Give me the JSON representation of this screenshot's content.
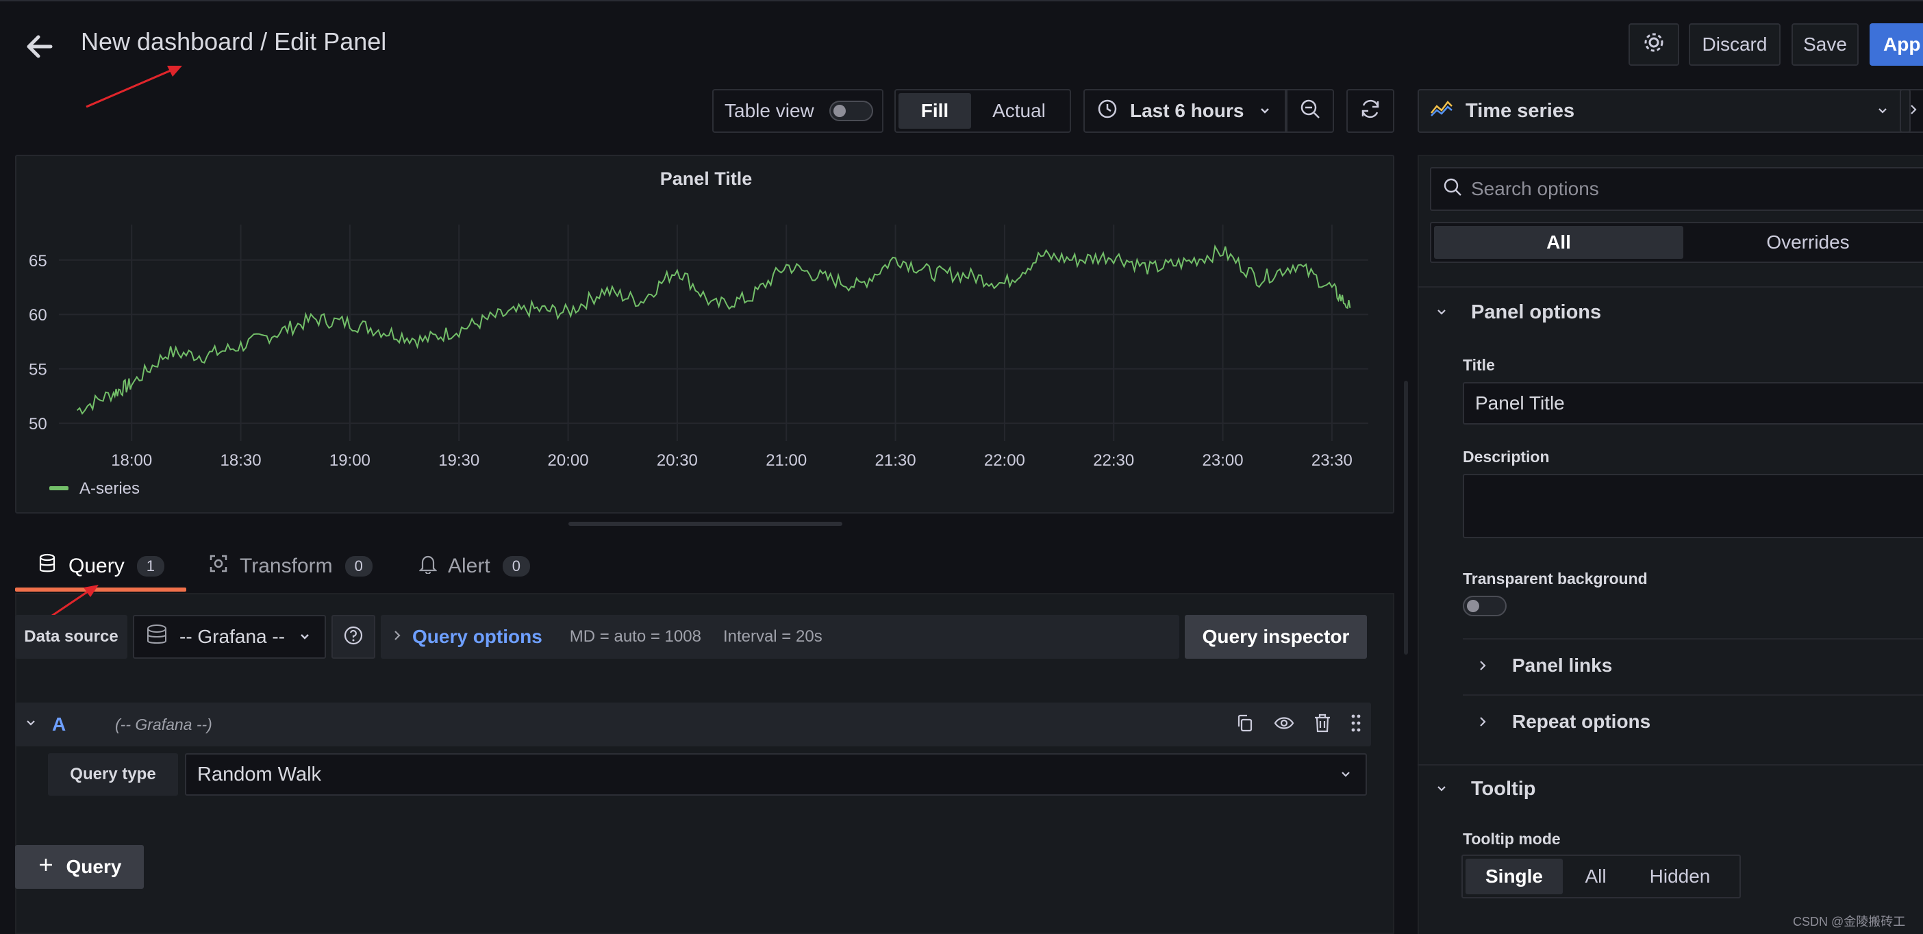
{
  "header": {
    "title": "New dashboard / Edit Panel",
    "discard_label": "Discard",
    "save_label": "Save",
    "apply_label": "Apply"
  },
  "toolbar": {
    "table_view_label": "Table view",
    "fill_label": "Fill",
    "actual_label": "Actual",
    "time_range": "Last 6 hours"
  },
  "panel": {
    "title": "Panel Title"
  },
  "chart_data": {
    "type": "line",
    "title": "Panel Title",
    "xlabel": "",
    "ylabel": "",
    "x_ticks": [
      "18:00",
      "18:30",
      "19:00",
      "19:30",
      "20:00",
      "20:30",
      "21:00",
      "21:30",
      "22:00",
      "22:30",
      "23:00",
      "23:30"
    ],
    "y_ticks": [
      50,
      55,
      60,
      65
    ],
    "ylim": [
      49,
      67
    ],
    "grid": true,
    "legend_placement": "bottom-left",
    "series": [
      {
        "name": "A-series",
        "color": "#73bf69",
        "x": [
          "17:45",
          "17:55",
          "18:00",
          "18:10",
          "18:20",
          "18:30",
          "18:40",
          "18:50",
          "19:00",
          "19:10",
          "19:20",
          "19:30",
          "19:40",
          "19:50",
          "20:00",
          "20:10",
          "20:20",
          "20:30",
          "20:40",
          "20:50",
          "21:00",
          "21:10",
          "21:20",
          "21:30",
          "21:40",
          "21:50",
          "22:00",
          "22:10",
          "22:20",
          "22:30",
          "22:40",
          "22:50",
          "23:00",
          "23:10",
          "23:20",
          "23:30",
          "23:35"
        ],
        "values": [
          51.2,
          52.8,
          53.6,
          56.5,
          56.2,
          57.1,
          58.3,
          59.6,
          59.2,
          58.4,
          57.6,
          58.6,
          59.8,
          60.5,
          60.2,
          62.2,
          61.2,
          64.2,
          60.8,
          61.5,
          64.5,
          63.4,
          62.6,
          65.2,
          63.8,
          63.6,
          62.8,
          65.4,
          65.0,
          65.4,
          64.2,
          64.8,
          65.8,
          63.2,
          64.6,
          62.4,
          60.6
        ]
      }
    ]
  },
  "query_tabs": [
    {
      "label": "Query",
      "count": "1"
    },
    {
      "label": "Transform",
      "count": "0"
    },
    {
      "label": "Alert",
      "count": "0"
    }
  ],
  "query": {
    "data_source_label": "Data source",
    "data_source_value": "-- Grafana --",
    "options_label": "Query options",
    "md_text": "MD = auto = 1008",
    "interval_text": "Interval = 20s",
    "inspector_label": "Query inspector",
    "row_letter": "A",
    "row_ds": "(-- Grafana --)",
    "query_type_label": "Query type",
    "query_type_value": "Random Walk",
    "add_query_label": "Query"
  },
  "options": {
    "visualization": "Time series",
    "search_placeholder": "Search options",
    "tab_all": "All",
    "tab_overrides": "Overrides",
    "panel_options_title": "Panel options",
    "title_label": "Title",
    "title_value": "Panel Title",
    "description_label": "Description",
    "transparent_label": "Transparent background",
    "panel_links": "Panel links",
    "repeat_options": "Repeat options",
    "tooltip_title": "Tooltip",
    "tooltip_mode_label": "Tooltip mode",
    "tooltip_modes": [
      "Single",
      "All",
      "Hidden"
    ]
  },
  "watermark": "CSDN @金陵搬砖工"
}
